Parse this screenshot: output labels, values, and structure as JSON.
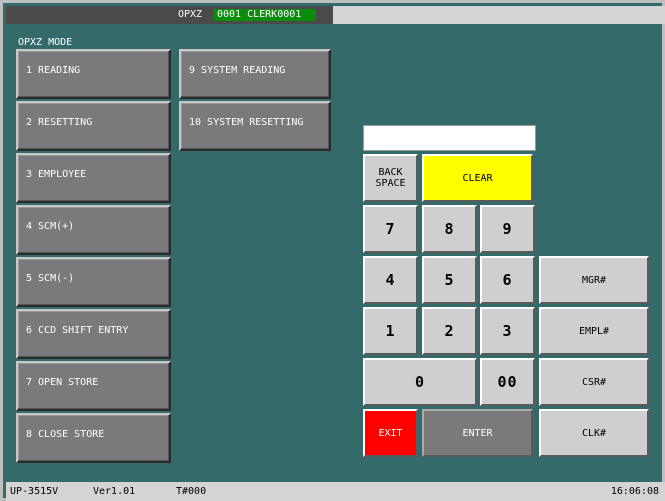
{
  "top_bar": {
    "mode_text": "OPXZ",
    "clerk_text": "0001 CLERK0001"
  },
  "mode_label": "OPXZ MODE",
  "function_buttons": [
    "1 READING",
    "2 RESETTING",
    "3 EMPLOYEE",
    "4 SCM(+)",
    "5 SCM(-)",
    "6 CCD SHIFT ENTRY",
    "7 OPEN STORE",
    "8 CLOSE STORE",
    "9 SYSTEM READING",
    "10 SYSTEM RESETTING"
  ],
  "display": {
    "value": ""
  },
  "keypad": {
    "backspace": "BACK SPACE",
    "clear": "CLEAR",
    "k7": "7",
    "k8": "8",
    "k9": "9",
    "k4": "4",
    "k5": "5",
    "k6": "6",
    "k1": "1",
    "k2": "2",
    "k3": "3",
    "k0": "0",
    "k00": "00",
    "exit": "EXIT",
    "enter": "ENTER",
    "mgr": "MGR#",
    "empl": "EMPL#",
    "csr": "CSR#",
    "clk": "CLK#"
  },
  "status_bar": {
    "model": "UP-3515V",
    "version": "Ver1.01",
    "terminal": "T#000",
    "time": "16:06:08"
  },
  "colors": {
    "background": "#356a6a",
    "clear_key": "#ffff00",
    "exit_key": "#ff0000",
    "enter_key": "#7a7a7a",
    "clerk_badge": "#0a8d0a"
  }
}
